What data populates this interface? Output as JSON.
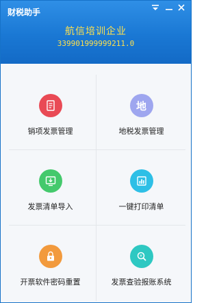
{
  "window": {
    "title": "财税助手",
    "menu_icon": "dropdown-menu-icon",
    "minimize_icon": "minimize-icon",
    "close_icon": "close-icon"
  },
  "company": {
    "name": "航信培训企业",
    "tax_id": "339901999999211.0"
  },
  "tiles": [
    {
      "label": "销项发票管理",
      "icon": "invoice-icon",
      "color": "#e94a55"
    },
    {
      "label": "地税发票管理",
      "icon": "local-tax-icon",
      "color": "#9ea6ef",
      "glyph": "地"
    },
    {
      "label": "发票清单导入",
      "icon": "import-icon",
      "color": "#44c96c"
    },
    {
      "label": "一键打印清单",
      "icon": "print-list-icon",
      "color": "#2ebfe6"
    },
    {
      "label": "开票软件密码重置",
      "icon": "lock-icon",
      "color": "#f29a3d"
    },
    {
      "label": "发票查验报账系统",
      "icon": "search-invoice-icon",
      "color": "#2ec8c2"
    }
  ]
}
